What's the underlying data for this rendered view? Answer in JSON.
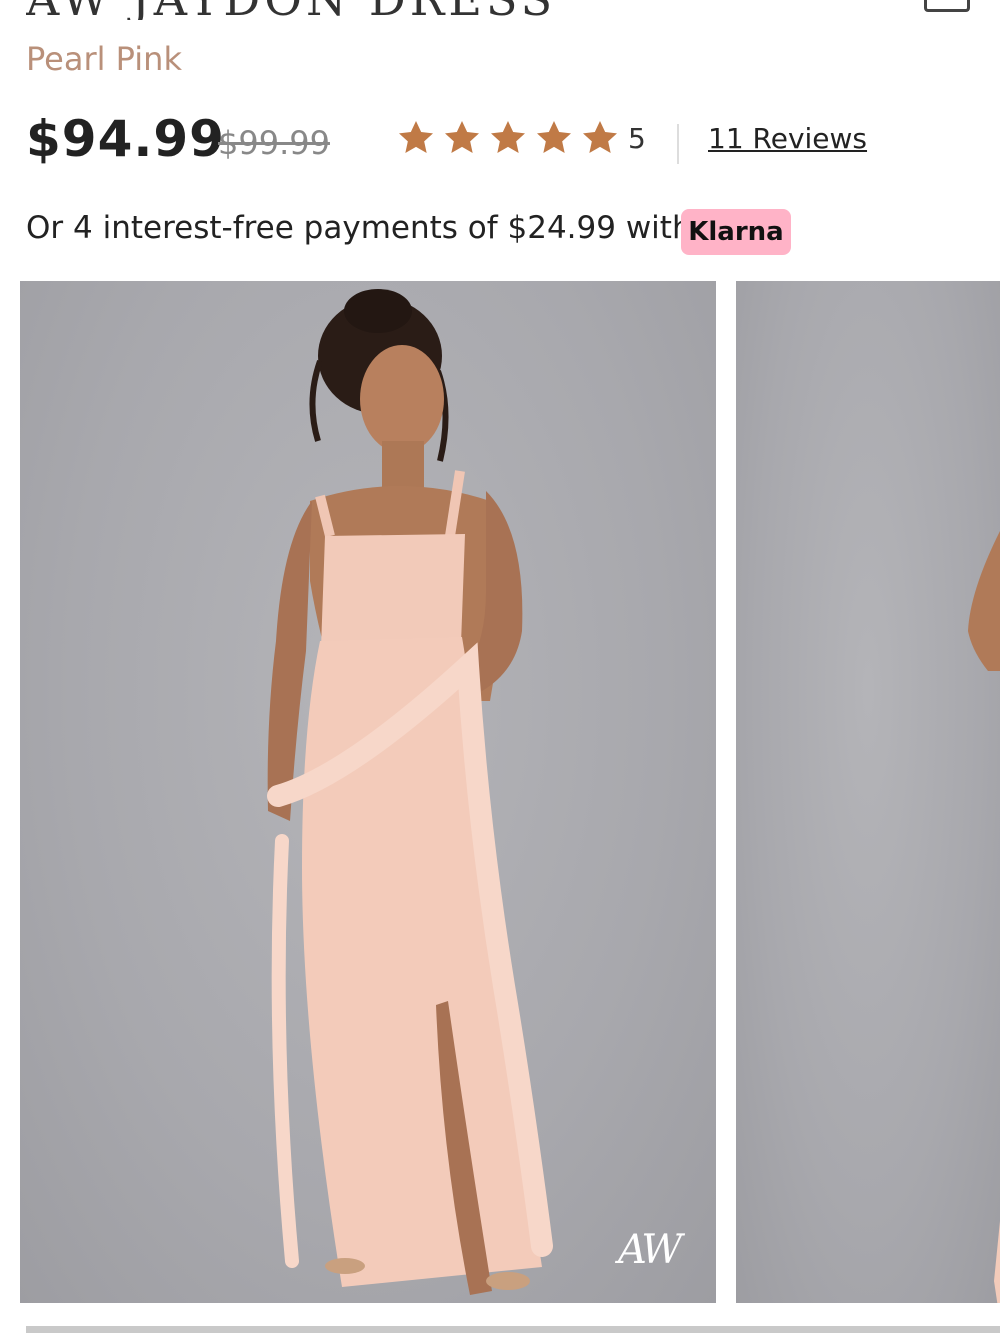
{
  "product": {
    "title": "AW JAYDON DRESS",
    "color": "Pearl Pink",
    "price": "$94.99",
    "original_price": "$99.99",
    "rating": {
      "stars": 5,
      "value_text": "5",
      "reviews_text": "11 Reviews"
    }
  },
  "payment": {
    "text": "Or 4 interest-free payments of $24.99 with",
    "provider": "Klarna"
  },
  "gallery": {
    "images": [
      {
        "alt": "Model wearing pearl pink ruffle maxi dress"
      },
      {
        "alt": "Second product view"
      }
    ],
    "watermark": "AW"
  },
  "colors": {
    "accent_star": "#c07a46",
    "color_name": "#b9907a",
    "klarna_bg": "#ffb3c7",
    "dress": "#f2c9b8"
  },
  "icons": [
    "star-icon",
    "bag-icon"
  ]
}
